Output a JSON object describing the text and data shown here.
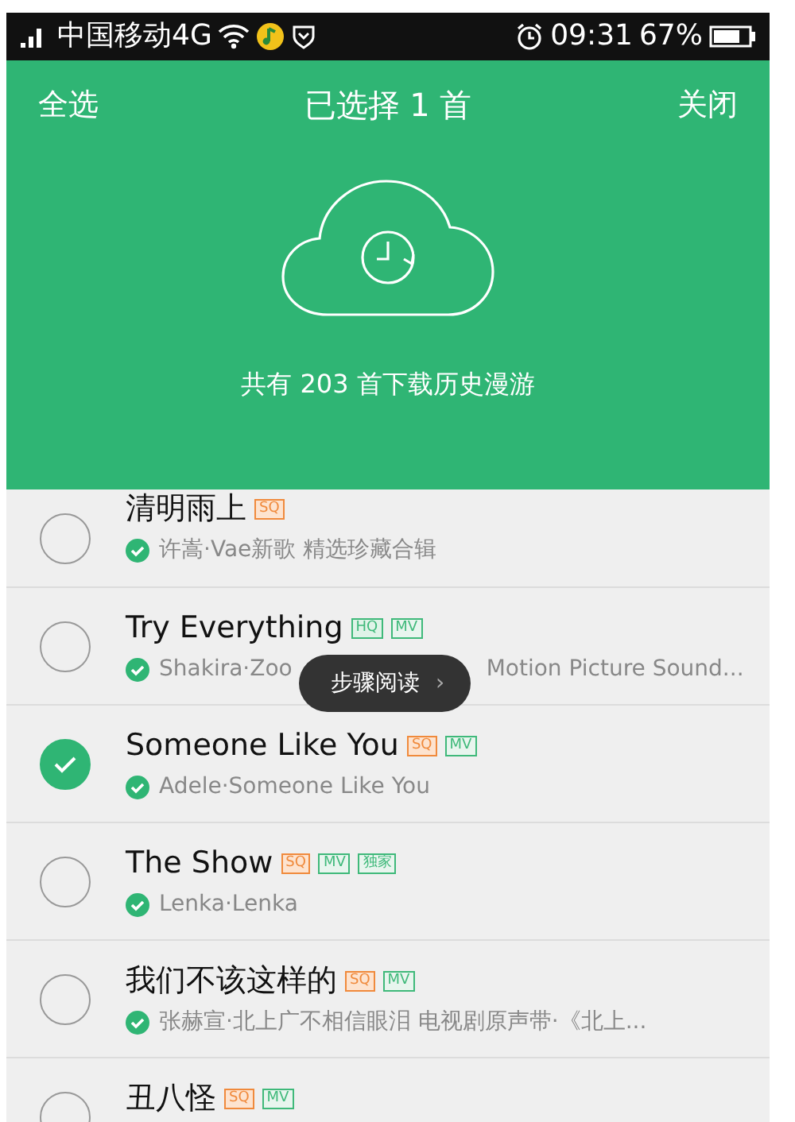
{
  "status_bar": {
    "carrier": "中国移动4G",
    "time": "09:31",
    "battery": "67%"
  },
  "header": {
    "select_all": "全选",
    "title": "已选择 1 首",
    "close": "关闭",
    "history": "共有 203 首下载历史漫游"
  },
  "songs": [
    {
      "title": "清明雨上",
      "tags": [
        {
          "kind": "sq",
          "text": "SQ"
        }
      ],
      "subtitle_parts": [
        "许嵩·Vae新歌 精选珍藏合辑"
      ],
      "selected": false
    },
    {
      "title": "Try Everything",
      "tags": [
        {
          "kind": "hq",
          "text": "HQ"
        },
        {
          "kind": "mv",
          "text": "MV"
        }
      ],
      "subtitle_parts": [
        "Shakira·Zoo",
        "Motion Picture Sound..."
      ],
      "selected": false
    },
    {
      "title": "Someone Like You",
      "tags": [
        {
          "kind": "sq",
          "text": "SQ"
        },
        {
          "kind": "mv",
          "text": "MV"
        }
      ],
      "subtitle_parts": [
        "Adele·Someone Like You"
      ],
      "selected": true
    },
    {
      "title": "The Show",
      "tags": [
        {
          "kind": "sq",
          "text": "SQ"
        },
        {
          "kind": "mv",
          "text": "MV"
        },
        {
          "kind": "exclusive",
          "text": "独家"
        }
      ],
      "subtitle_parts": [
        "Lenka·Lenka"
      ],
      "selected": false
    },
    {
      "title": "我们不该这样的",
      "tags": [
        {
          "kind": "sq",
          "text": "SQ"
        },
        {
          "kind": "mv",
          "text": "MV"
        }
      ],
      "subtitle_parts": [
        "张赫宣·北上广不相信眼泪 电视剧原声带·《北上..."
      ],
      "selected": false
    },
    {
      "title": "丑八怪",
      "tags": [
        {
          "kind": "sq",
          "text": "SQ"
        },
        {
          "kind": "mv",
          "text": "MV"
        }
      ],
      "selected": false
    }
  ],
  "toast": {
    "text": "步骤阅读",
    "arrow": "›"
  }
}
